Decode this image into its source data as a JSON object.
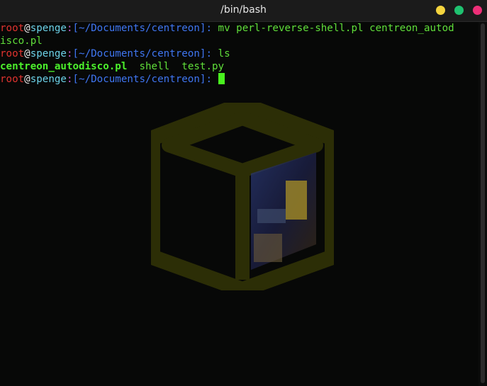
{
  "window": {
    "title": "/bin/bash",
    "controls": [
      "minimize",
      "maximize",
      "close"
    ],
    "colors": {
      "minimize": "#f4d43e",
      "maximize": "#1fc270",
      "close": "#ee2f78"
    }
  },
  "terminal": {
    "prompt": {
      "user": "root",
      "at": "@",
      "host": "spenge",
      "colon": ":",
      "path": "[~/Documents/centreon]",
      "suffix": ": "
    },
    "lines": [
      {
        "command": "mv perl-reverse-shell.pl centreon_autod",
        "wrap": "isco.pl"
      },
      {
        "command": "ls"
      }
    ],
    "ls_output": {
      "exe": "centreon_autodisco.pl",
      "dir1": "shell",
      "file": "test.py"
    },
    "colors": {
      "user": "#e0332f",
      "host": "#6cd2e8",
      "path": "#3f76f2",
      "command": "#60df3a",
      "cursor": "#49f21e",
      "logo": "#2c2e06"
    }
  },
  "background_logo": {
    "icon": "cube-icon"
  }
}
